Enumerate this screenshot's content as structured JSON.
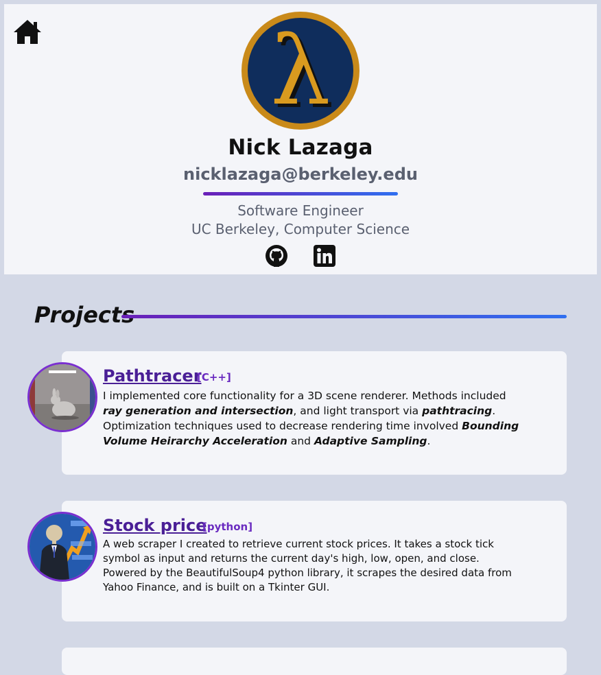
{
  "header": {
    "name": "Nick Lazaga",
    "email": "nicklazaga@berkeley.edu",
    "role": "Software Engineer",
    "school": "UC Berkeley, Computer Science",
    "logo_glyph": "λ",
    "icons": [
      "home-icon",
      "github-icon",
      "linkedin-icon"
    ]
  },
  "colors": {
    "accent_purple": "#6a1fb8",
    "accent_blue": "#2f6ff0",
    "logo_fill": "#0f2d5c",
    "logo_ring": "#c98a1a"
  },
  "projects": {
    "heading": "Projects",
    "items": [
      {
        "title": "Pathtracer",
        "lang": "[C++]",
        "desc": [
          {
            "t": "I implemented core functionality for a 3D scene renderer. Methods included ",
            "b": false
          },
          {
            "t": "ray generation and intersection",
            "b": true
          },
          {
            "t": ", and light transport via ",
            "b": false
          },
          {
            "t": "pathtracing",
            "b": true
          },
          {
            "t": ". Optimization techniques used to decrease rendering time involved ",
            "b": false
          },
          {
            "t": "Bounding Volume Heirarchy Acceleration",
            "b": true
          },
          {
            "t": " and ",
            "b": false
          },
          {
            "t": "Adaptive Sampling",
            "b": true
          },
          {
            "t": ".",
            "b": false
          }
        ]
      },
      {
        "title": "Stock price",
        "lang": "[python]",
        "desc": "A web scraper I created to retrieve current stock prices. It takes a stock tick symbol as input and returns the current day's high, low, open, and close. Powered by the BeautifulSoup4 python library, it scrapes the desired data from Yahoo Finance, and is built on a Tkinter GUI."
      }
    ]
  }
}
